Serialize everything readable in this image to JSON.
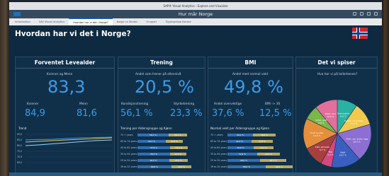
{
  "window": {
    "title": "SAP® Visual Analytics - Explore and Visualize"
  },
  "shell": {
    "title": "Hur mår Norge"
  },
  "tabs": [
    {
      "label": "Introduction"
    },
    {
      "label": "SAV Visual Analytics"
    },
    {
      "label": "Hvordan har vi det i Norge?"
    },
    {
      "label": "Norge vs Verden"
    },
    {
      "label": "Grupper"
    },
    {
      "label": "Tilgjengelige Norske"
    }
  ],
  "page": {
    "title": "Hvordan har vi det i Norge?"
  },
  "panels": {
    "levealder": {
      "title": "Forventet Levealder",
      "all_label": "Kvinner og Menn",
      "all_value": "83,3",
      "women_label": "Kvinner",
      "women_value": "84,9",
      "men_label": "Menn",
      "men_value": "81,6",
      "trend_label": "Trend",
      "trend_ticks": [
        "90,0",
        "85,0",
        "80,0",
        "75,0",
        "70,0",
        "65,0"
      ]
    },
    "trening": {
      "title": "Trening",
      "all_label": "Andel som trener på ellevnivå",
      "all_value": "20,5 %",
      "kond_label": "Kondisjonstrening",
      "kond_value": "56,1 %",
      "styrke_label": "Styrketrening",
      "styrke_value": "23,3 %",
      "chart_label": "Trening per Aldersgruppe og Kjønn",
      "rows": [
        {
          "cat": "75 + years",
          "a": "56,2 %",
          "b": "26,1 %"
        },
        {
          "cat": "65 to 74 years",
          "a": "50,1 %",
          "b": "22,8 %"
        },
        {
          "cat": "45 to 64 years",
          "a": "57,6 %",
          "b": "23,9 %"
        },
        {
          "cat": "35 to 44 years",
          "a": "58,3 %",
          "b": "21,4 %"
        },
        {
          "cat": "25 to 34 years",
          "a": "56,0 %",
          "b": "25,2 %"
        },
        {
          "cat": "16 to 24 years",
          "a": "60,8 %",
          "b": "28,7 %"
        }
      ]
    },
    "bmi": {
      "title": "BMI",
      "all_label": "Andel med normal vekt",
      "all_value": "49,8 %",
      "over_label": "Andel overvektige",
      "over_value": "37,6 %",
      "bmi30_label": "BMI -> 30",
      "bmi30_value": "12,5 %",
      "chart_label": "Normal vekt per Aldersgruppe og Kjønn",
      "rows": [
        {
          "cat": "75 + years",
          "a": "44,1 %",
          "b": "39,6 %"
        },
        {
          "cat": "65 to 74 years",
          "a": "42,3 %",
          "b": "37,0 %"
        },
        {
          "cat": "45 to 64 years",
          "a": "45,8 %",
          "b": "34,1 %"
        },
        {
          "cat": "35 to 44 years",
          "a": "52,9 %",
          "b": "40,2 %"
        },
        {
          "cat": "25 to 34 years",
          "a": "58,0 %",
          "b": "46,3 %"
        },
        {
          "cat": "16 to 24 years",
          "a": "68,2 %",
          "b": "60,5 %"
        }
      ]
    },
    "spiser": {
      "title": "Det vi spiser",
      "chart_label": "Hva har vi på tallerkenen?",
      "slices": [
        {
          "label": "Grønnsaker",
          "value": "9,6 %",
          "color": "#2bb1a3"
        },
        {
          "label": "Sukker og godteri",
          "value": "11,0 %",
          "color": "#f2c94c"
        },
        {
          "label": "Melk, ost, kjeks, egg",
          "value": "18,0 %",
          "color": "#8c6fd1"
        },
        {
          "label": "Kjøtt",
          "value": "14,0 %",
          "color": "#3b5fc0"
        },
        {
          "label": "Fisk",
          "value": "5,3 %",
          "color": "#d6487e"
        },
        {
          "label": "Fett, sørsaker",
          "value": "9,7 %",
          "color": "#a83f3f"
        },
        {
          "label": "Frukt og bær",
          "value": "14,6 %",
          "color": "#e58e3c"
        },
        {
          "label": "Potet, grøt",
          "value": "6,8 %",
          "color": "#7ab648"
        },
        {
          "label": "Brød, mel",
          "value": "10,9 %",
          "color": "#e26f9c"
        }
      ]
    }
  },
  "colors": {
    "accent": "#3d9be8",
    "bar_primary": "#2f6fb5",
    "bar_secondary": "#b9a85f"
  }
}
